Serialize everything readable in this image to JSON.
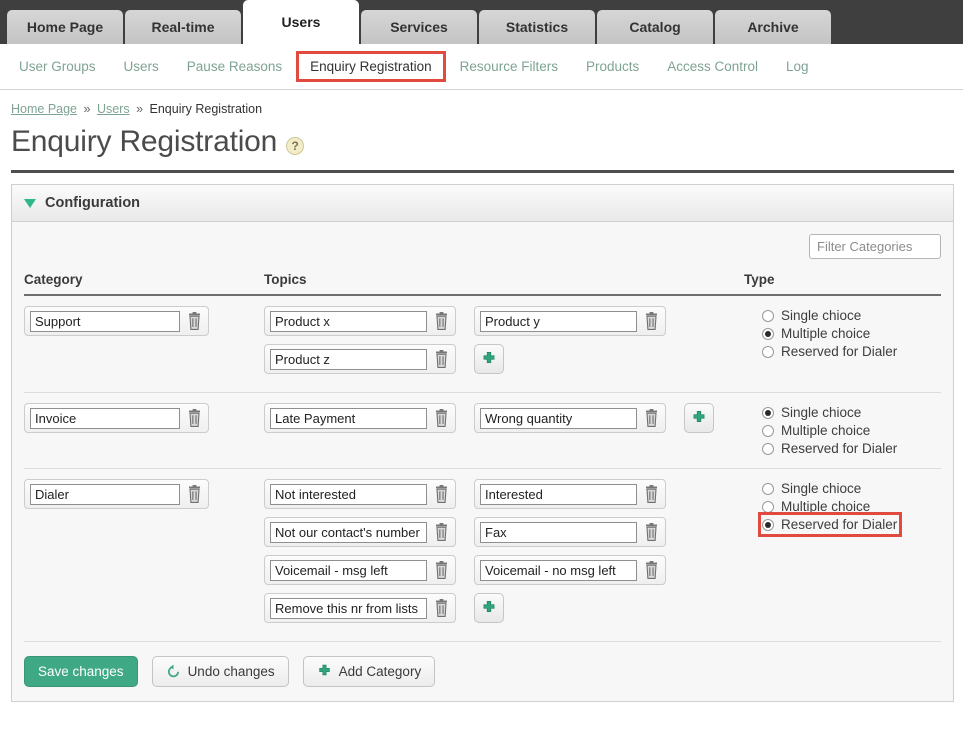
{
  "main_tabs": [
    {
      "label": "Home Page",
      "active": false
    },
    {
      "label": "Real-time",
      "active": false
    },
    {
      "label": "Users",
      "active": true
    },
    {
      "label": "Services",
      "active": false
    },
    {
      "label": "Statistics",
      "active": false
    },
    {
      "label": "Catalog",
      "active": false
    },
    {
      "label": "Archive",
      "active": false
    }
  ],
  "sub_nav": [
    {
      "label": "User Groups",
      "active": false,
      "highlighted": false
    },
    {
      "label": "Users",
      "active": false,
      "highlighted": false
    },
    {
      "label": "Pause Reasons",
      "active": false,
      "highlighted": false
    },
    {
      "label": "Enquiry Registration",
      "active": true,
      "highlighted": true
    },
    {
      "label": "Resource Filters",
      "active": false,
      "highlighted": false
    },
    {
      "label": "Products",
      "active": false,
      "highlighted": false
    },
    {
      "label": "Access Control",
      "active": false,
      "highlighted": false
    },
    {
      "label": "Log",
      "active": false,
      "highlighted": false
    }
  ],
  "breadcrumb": {
    "items": [
      "Home Page",
      "Users"
    ],
    "separator": "»",
    "current": "Enquiry Registration"
  },
  "page": {
    "title": "Enquiry Registration",
    "help_icon": "question-mark-icon",
    "help_glyph": "?"
  },
  "panel": {
    "title": "Configuration",
    "toggle_icon": "triangle-down-icon",
    "expanded": true
  },
  "filter": {
    "placeholder": "Filter Categories",
    "value": ""
  },
  "table": {
    "headers": {
      "category": "Category",
      "topics": "Topics",
      "type": "Type"
    }
  },
  "type_options": [
    "Single chioce",
    "Multiple choice",
    "Reserved for Dialer"
  ],
  "categories": [
    {
      "name": "Support",
      "topics": [
        "Product x",
        "Product y",
        "Product z"
      ],
      "selected_type": 1,
      "type_highlighted": false,
      "add_topic_icon": "plus-icon"
    },
    {
      "name": "Invoice",
      "topics": [
        "Late Payment",
        "Wrong quantity"
      ],
      "selected_type": 0,
      "type_highlighted": false,
      "add_topic_icon": "plus-icon"
    },
    {
      "name": "Dialer",
      "topics": [
        "Not interested",
        "Interested",
        "Not our contact's number",
        "Fax",
        "Voicemail - msg left",
        "Voicemail - no msg left",
        "Remove this nr from lists"
      ],
      "selected_type": 2,
      "type_highlighted": true,
      "add_topic_icon": "plus-icon"
    }
  ],
  "footer": {
    "save_label": "Save changes",
    "undo_label": "Undo changes",
    "undo_icon": "undo-arrow-icon",
    "add_category_label": "Add Category",
    "add_category_icon": "plus-icon"
  },
  "colors": {
    "accent_teal": "#3fa985",
    "tabbar_dark": "#3f3f3f",
    "link_green": "#7fa393",
    "highlight_red": "#e04a3f"
  }
}
